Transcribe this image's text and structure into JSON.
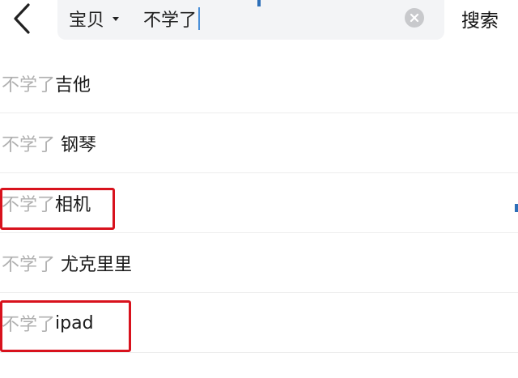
{
  "header": {
    "back_icon": "chevron-left-icon",
    "search": {
      "scope_label": "宝贝",
      "query_value": "不学了",
      "clear_icon": "close-circle-icon"
    },
    "search_button_label": "搜索"
  },
  "suggestions": [
    {
      "prefix": "不学了",
      "suffix": "吉他",
      "highlighted": false
    },
    {
      "prefix": "不学了",
      "suffix": " 钢琴",
      "highlighted": false
    },
    {
      "prefix": "不学了",
      "suffix": "相机",
      "highlighted": true
    },
    {
      "prefix": "不学了",
      "suffix": " 尤克里里",
      "highlighted": false
    },
    {
      "prefix": "不学了",
      "suffix": "ipad",
      "highlighted": true
    }
  ],
  "colors": {
    "highlight": "#d8121d",
    "prefix_text": "#b0b0b0",
    "search_bg": "#f3f4f6"
  }
}
